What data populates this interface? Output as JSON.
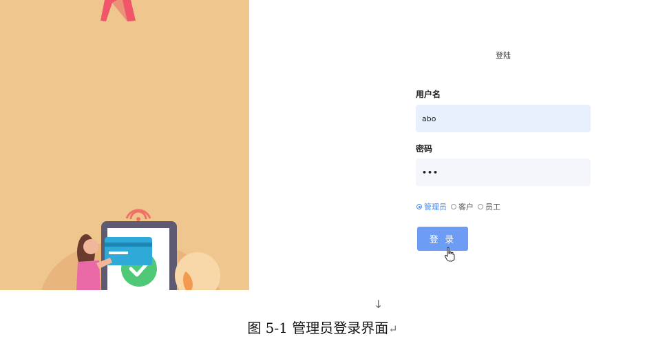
{
  "login": {
    "title": "登陆",
    "username_label": "用户名",
    "username_value": "abo",
    "password_label": "密码",
    "password_value": "•••",
    "roles": [
      {
        "label": "管理员",
        "selected": true
      },
      {
        "label": "客户",
        "selected": false
      },
      {
        "label": "员工",
        "selected": false
      }
    ],
    "submit_label": "登 录"
  },
  "document": {
    "paragraph_mark": "↓",
    "caption": "图 5-1 管理员登录界面",
    "return_mark": "↵"
  },
  "colors": {
    "illustration_bg": "#efc78e",
    "accent": "#4a8af4",
    "button": "#6c9cf3",
    "username_bg": "#e8f0fe"
  },
  "icons": {
    "cursor": "hand-pointer-icon"
  }
}
